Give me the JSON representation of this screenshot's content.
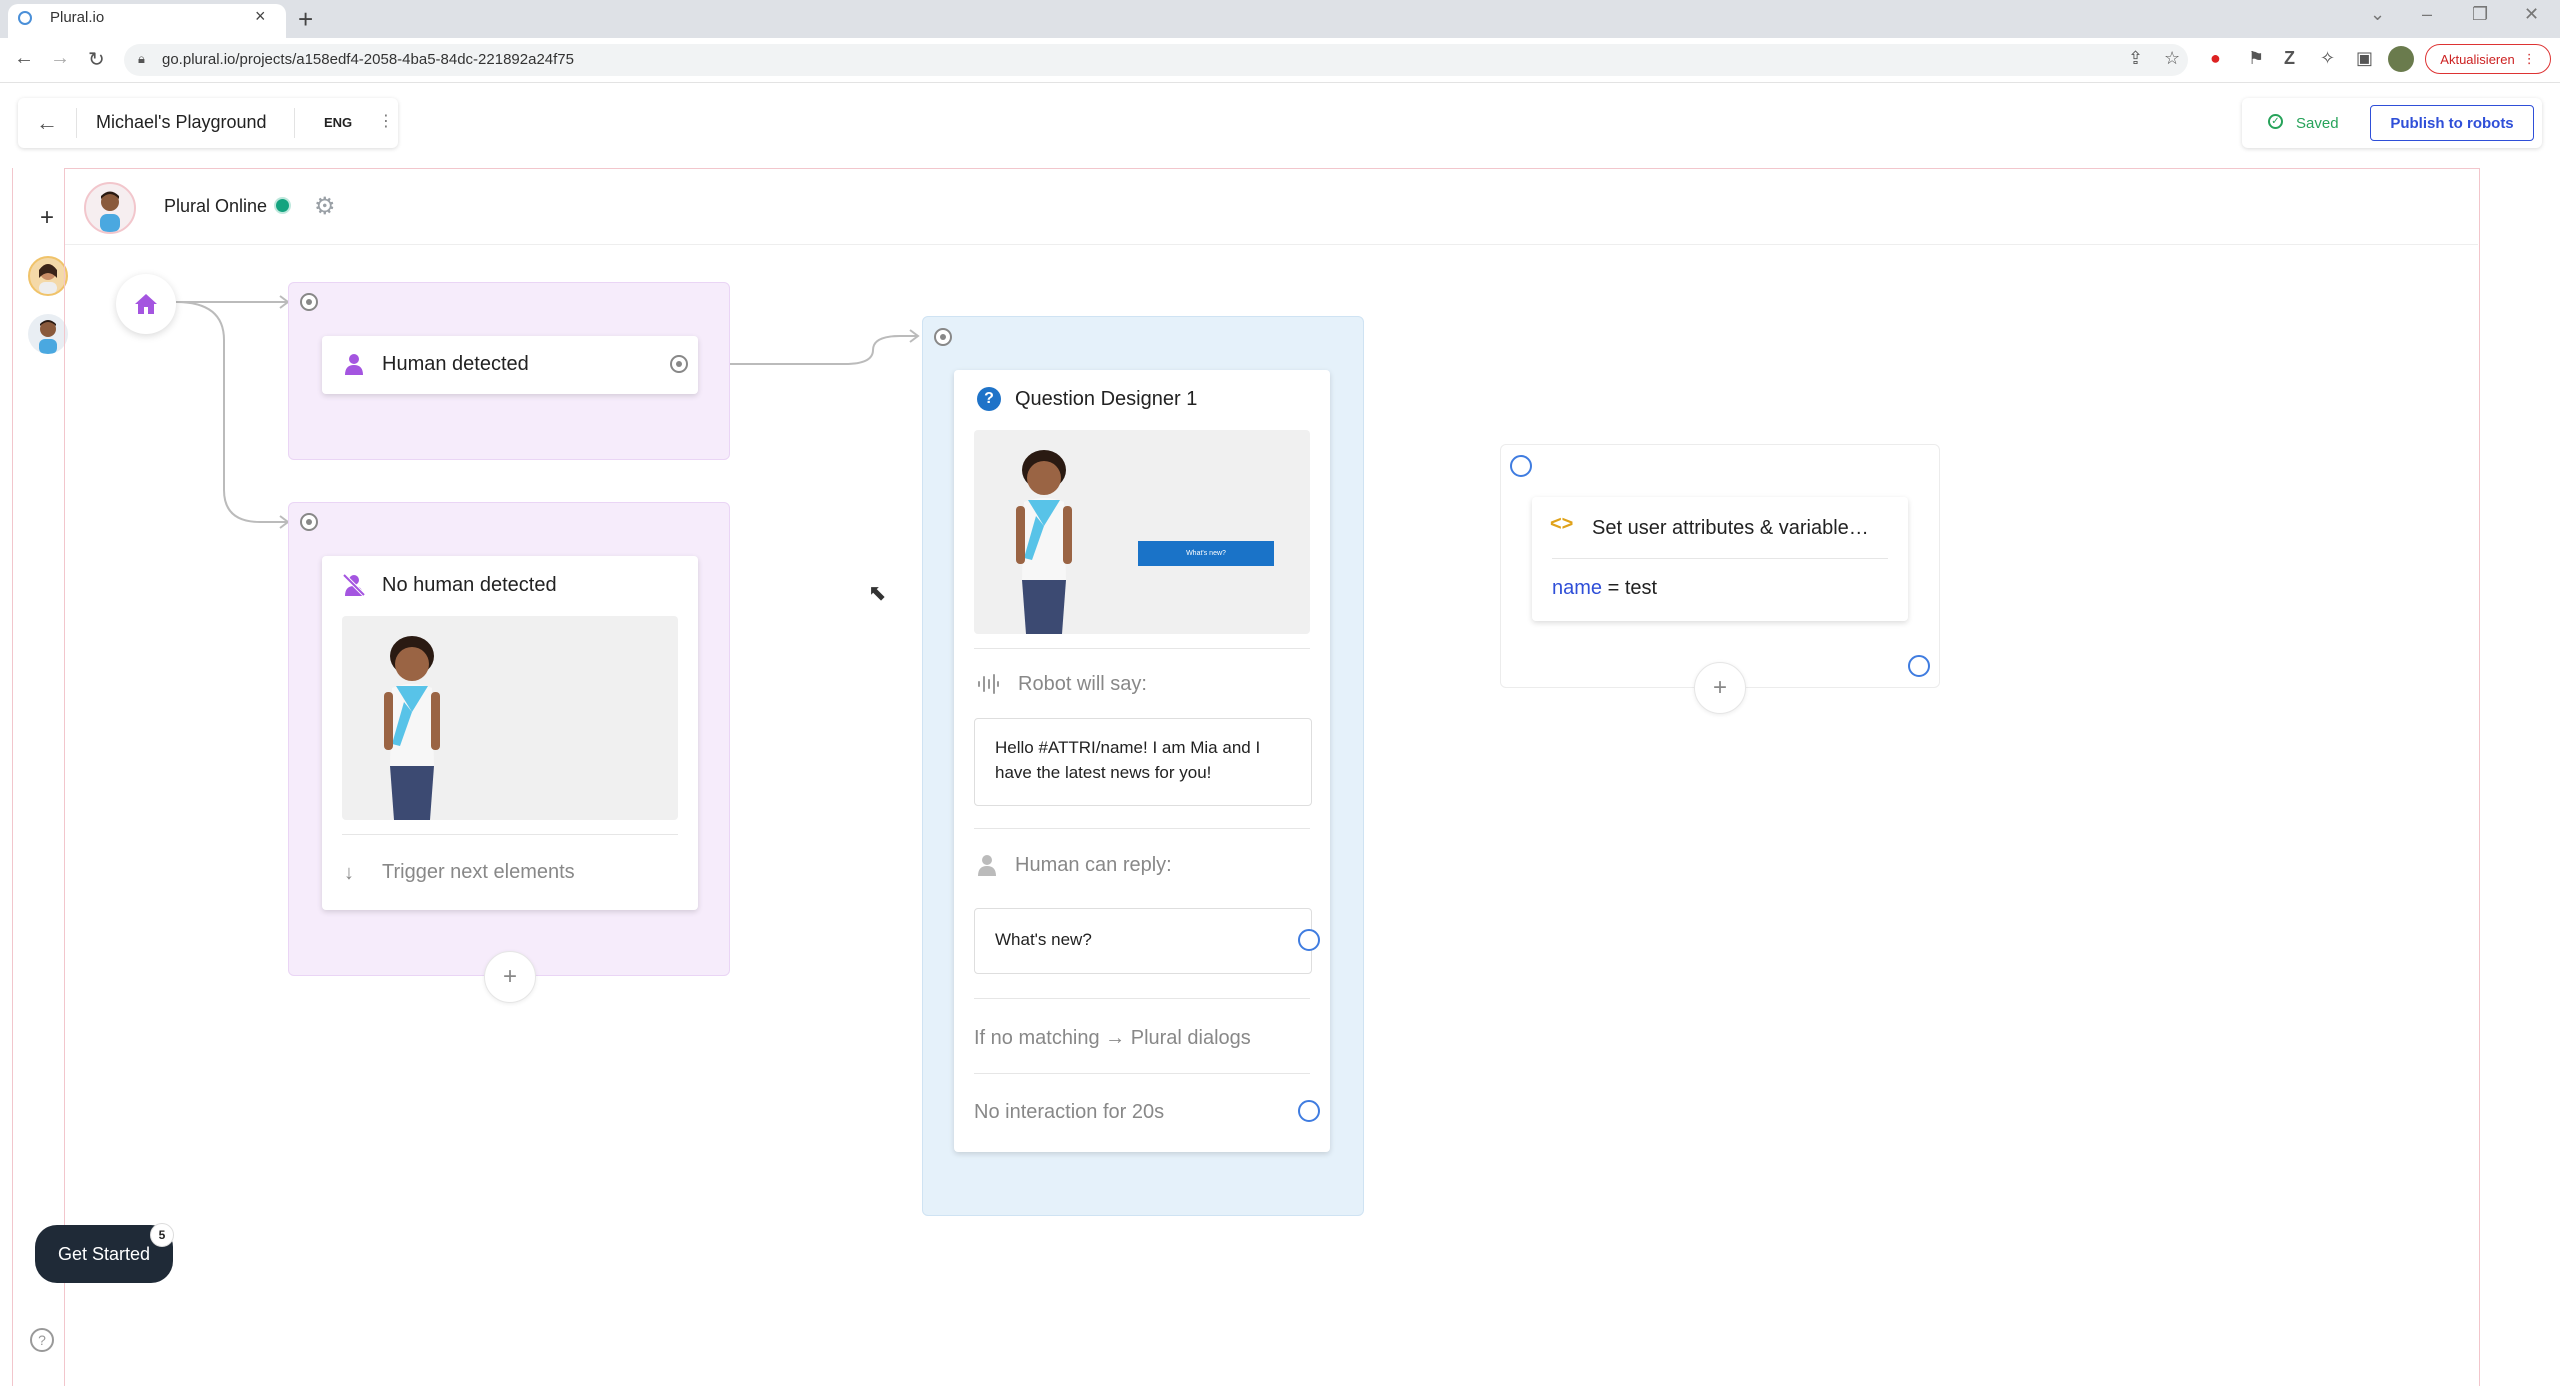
{
  "browser": {
    "tab_title": "Plural.io",
    "tab_close": "×",
    "new_tab": "+",
    "url": "go.plural.io/projects/a158edf4-2058-4ba5-84dc-221892a24f75",
    "update_label": "Aktualisieren"
  },
  "header": {
    "project_name": "Michael's Playground",
    "language": "ENG",
    "saved_label": "Saved",
    "publish_label": "Publish to robots"
  },
  "robot": {
    "name": "Plural Online",
    "status_color": "#14a37f"
  },
  "flow": {
    "human_detected": {
      "title": "Human detected"
    },
    "no_human_detected": {
      "title": "No human detected",
      "trigger_label": "Trigger next elements"
    },
    "question_designer": {
      "title": "Question Designer 1",
      "preview_button": "What's new?",
      "robot_will_say_label": "Robot will say:",
      "robot_says": "Hello #ATTRI/name! I am Mia and I have the latest news for you!",
      "human_can_reply_label": "Human can reply:",
      "reply_option": "What's new?",
      "no_match_label": "If no matching → Plural dialogs",
      "no_interaction_label": "No interaction for 20s"
    },
    "set_attributes": {
      "title": "Set user attributes & variable…",
      "attr_name": "name",
      "attr_op": " = ",
      "attr_value": "test"
    }
  },
  "footer": {
    "get_started_label": "Get Started",
    "get_started_badge": "5",
    "help_label": "?"
  },
  "colors": {
    "accent_purple": "#a455e0",
    "accent_blue": "#2f4fd8",
    "saved_green": "#27a35a"
  }
}
